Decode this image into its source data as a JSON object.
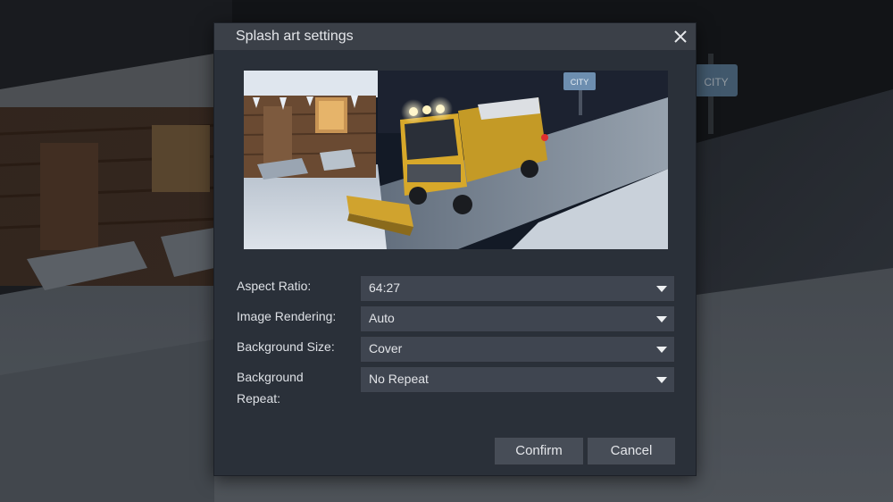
{
  "dialog": {
    "title": "Splash art settings",
    "close_icon": "close-icon"
  },
  "preview": {
    "sign_text": "CITY"
  },
  "backdrop": {
    "sign_text": "CITY"
  },
  "form": {
    "aspect_ratio": {
      "label": "Aspect Ratio:",
      "value": "64:27"
    },
    "image_rendering": {
      "label": "Image Rendering:",
      "value": "Auto"
    },
    "background_size": {
      "label": "Background Size:",
      "value": "Cover"
    },
    "background_repeat": {
      "label": "Background Repeat:",
      "value": "No Repeat"
    }
  },
  "buttons": {
    "confirm": "Confirm",
    "cancel": "Cancel"
  },
  "colors": {
    "dialog_bg": "#2a3039",
    "titlebar_bg": "#3b4048",
    "select_bg": "#3f4550",
    "button_bg": "#474d57",
    "text": "#e2e4e8"
  }
}
